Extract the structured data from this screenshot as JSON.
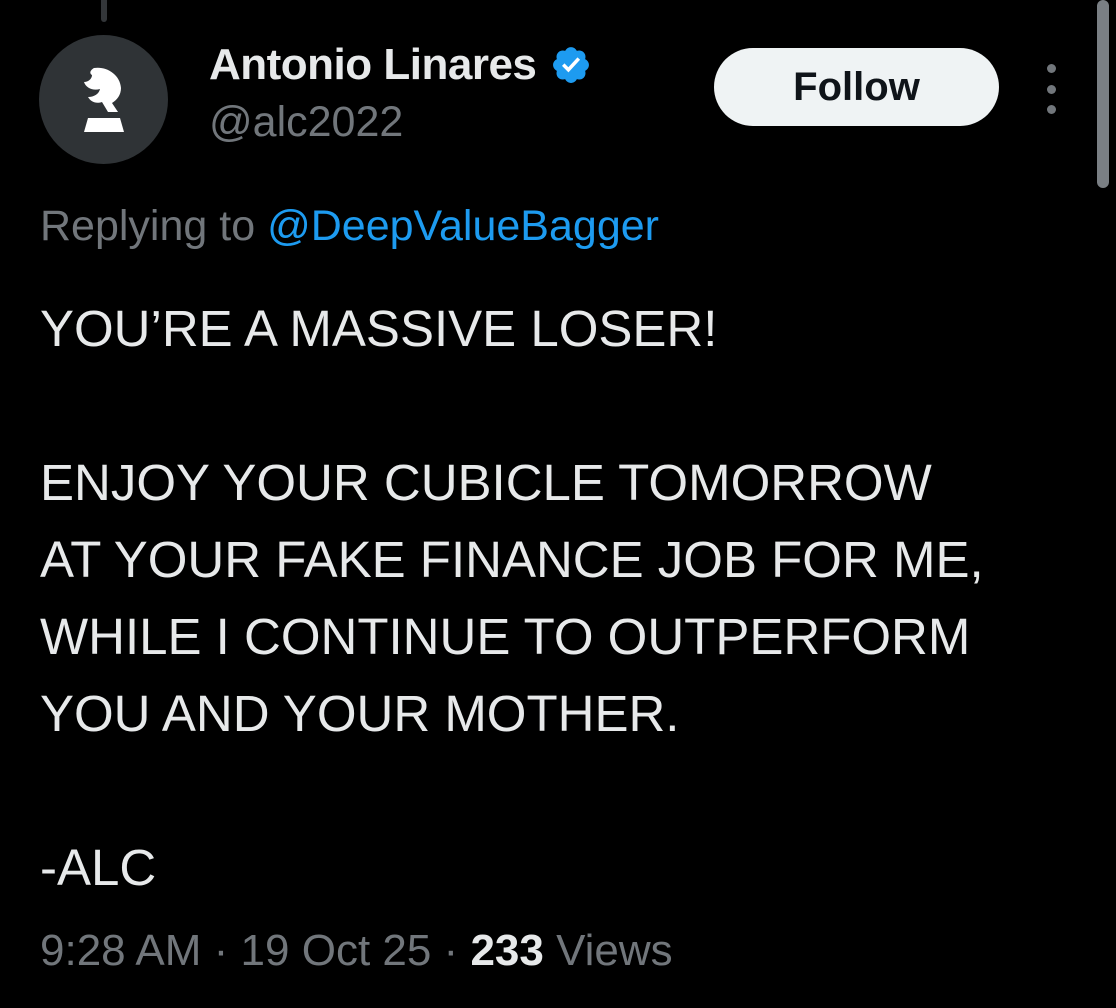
{
  "author": {
    "display_name": "Antonio Linares",
    "handle": "@alc2022",
    "avatar_icon": "chess-knight-icon",
    "verified_icon": "verified-badge-icon",
    "verified_color": "#1d9bf0"
  },
  "actions": {
    "follow_label": "Follow",
    "more_icon": "more-vertical-icon"
  },
  "reply": {
    "prefix": "Replying to ",
    "mention": "@DeepValueBagger"
  },
  "tweet": {
    "lines": [
      "YOU’RE A MASSIVE LOSER!",
      "",
      "ENJOY YOUR CUBICLE TOMORROW",
      "AT YOUR FAKE FINANCE JOB FOR ME,",
      "WHILE I CONTINUE TO OUTPERFORM",
      "YOU AND YOUR MOTHER.",
      "",
      "-ALC"
    ]
  },
  "meta": {
    "time": "9:28 AM",
    "separator": " · ",
    "date": "19 Oct 25",
    "views_count": "233",
    "views_label": " Views"
  },
  "colors": {
    "background": "#000000",
    "text_primary": "#e7e9ea",
    "text_secondary": "#71767b",
    "link": "#1d9bf0",
    "follow_button_bg": "#eff3f4"
  }
}
